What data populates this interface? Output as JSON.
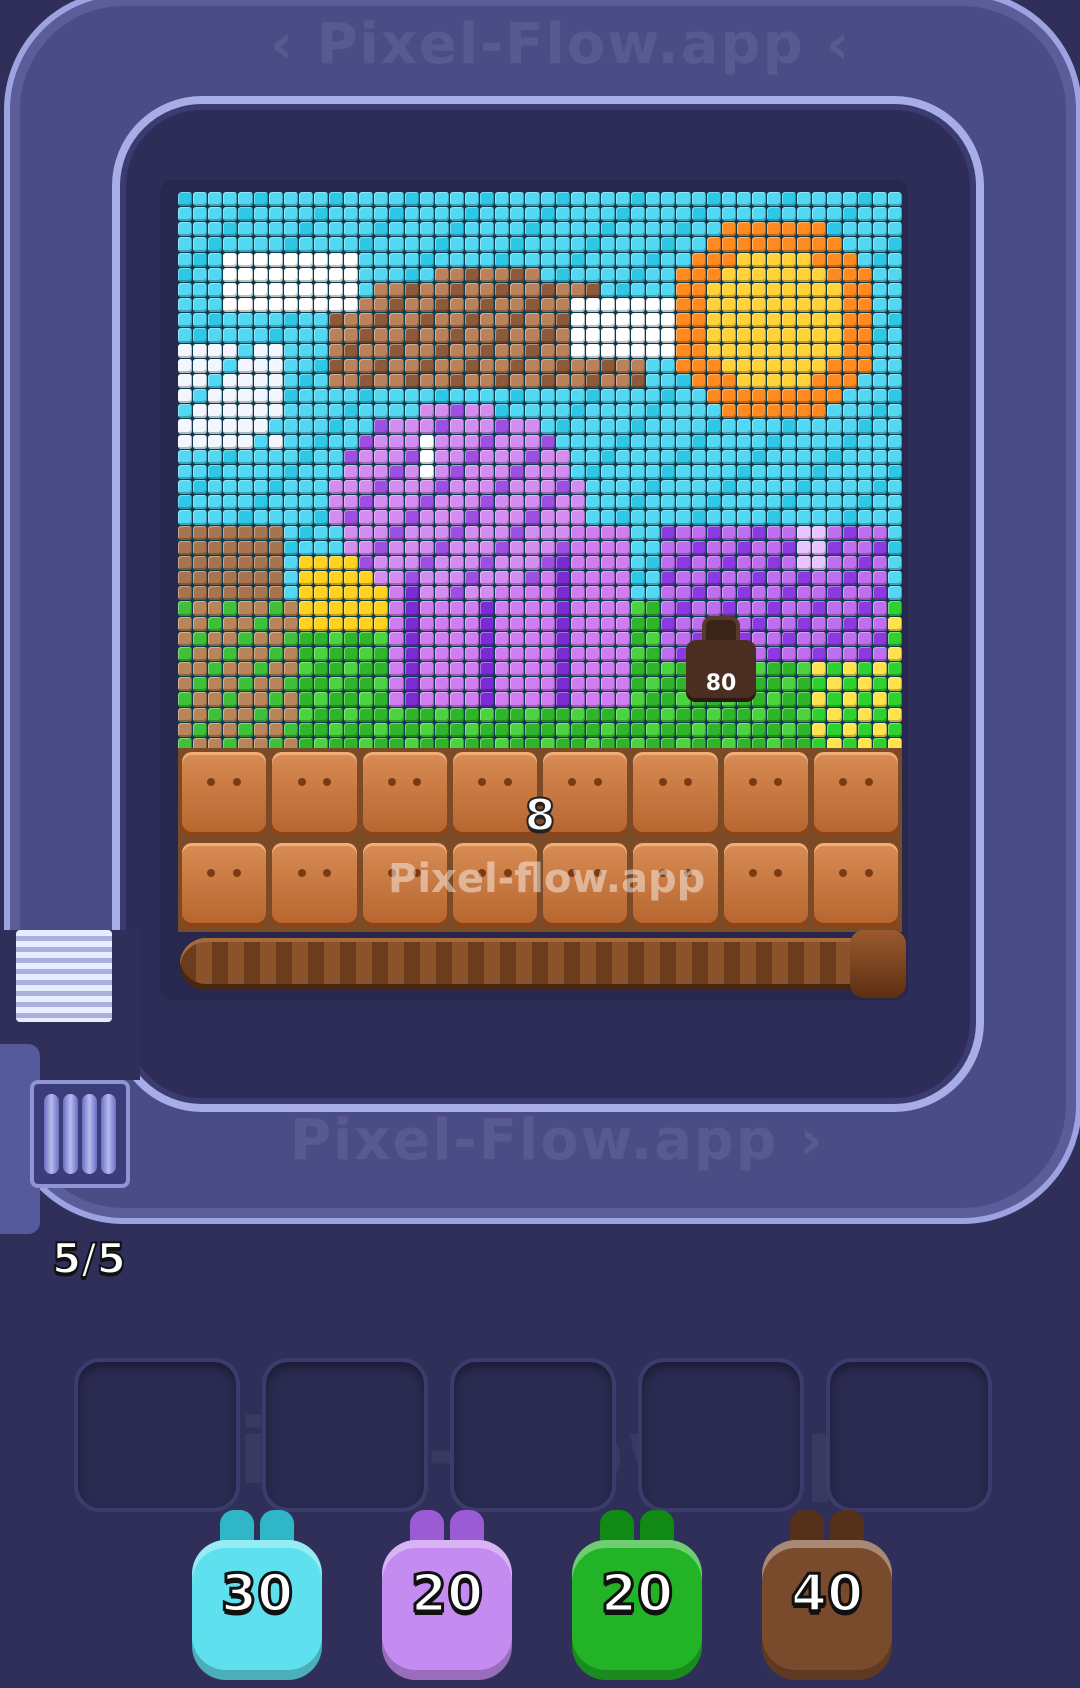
{
  "watermark": {
    "top": "‹ Pixel-Flow.app ‹",
    "bottom": "Pixel-Flow.app ›",
    "slots": "Pixel-Flow.app",
    "board": "Pixel-flow.app"
  },
  "board": {
    "crate_count": "8",
    "lock_value": "80"
  },
  "conveyor": {
    "capacity": "5/5"
  },
  "slots": {
    "count": 5
  },
  "shooters": [
    {
      "label": "30",
      "color": "#5fe0ee",
      "dark": "#2fb7c8"
    },
    {
      "label": "20",
      "color": "#c48cf0",
      "dark": "#9a5bd4"
    },
    {
      "label": "20",
      "color": "#22b327",
      "dark": "#118a15"
    },
    {
      "label": "40",
      "color": "#7a4a2c",
      "dark": "#55301a"
    }
  ]
}
